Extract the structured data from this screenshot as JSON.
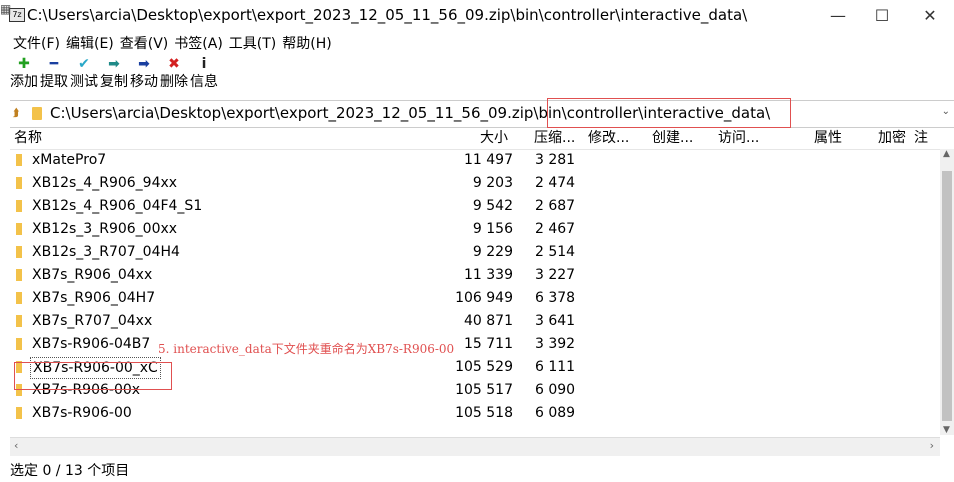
{
  "window": {
    "title": "C:\\Users\\arcia\\Desktop\\export\\export_2023_12_05_11_56_09.zip\\bin\\controller\\interactive_data\\",
    "minimize": "—",
    "maximize": "☐",
    "close": "✕"
  },
  "menu": [
    "文件(F)",
    "编辑(E)",
    "查看(V)",
    "书签(A)",
    "工具(T)",
    "帮助(H)"
  ],
  "toolbar": [
    {
      "label": "添加",
      "icon": "plus-icon",
      "glyph": "✚",
      "color": "#22a020"
    },
    {
      "label": "提取",
      "icon": "minus-icon",
      "glyph": "━",
      "color": "#1a3fa0"
    },
    {
      "label": "测试",
      "icon": "check-icon",
      "glyph": "✔",
      "color": "#2aa8c8"
    },
    {
      "label": "复制",
      "icon": "copy-arrow-icon",
      "glyph": "➡",
      "color": "#1f8a88"
    },
    {
      "label": "移动",
      "icon": "move-arrow-icon",
      "glyph": "➡",
      "color": "#1a3fa0"
    },
    {
      "label": "删除",
      "icon": "delete-icon",
      "glyph": "✖",
      "color": "#d32020"
    },
    {
      "label": "信息",
      "icon": "info-icon",
      "glyph": "i",
      "color": "#222222"
    }
  ],
  "address": {
    "path": "C:\\Users\\arcia\\Desktop\\export\\export_2023_12_05_11_56_09.zip\\bin\\controller\\interactive_data\\"
  },
  "columns": [
    "名称",
    "大小",
    "压缩...",
    "修改...",
    "创建...",
    "访问...",
    "属性",
    "加密",
    "注"
  ],
  "files": [
    {
      "name": "xMatePro7",
      "size": "11 497",
      "compressed": "3 281"
    },
    {
      "name": "XB12s_4_R906_94xx",
      "size": "9 203",
      "compressed": "2 474"
    },
    {
      "name": "XB12s_4_R906_04F4_S1",
      "size": "9 542",
      "compressed": "2 687"
    },
    {
      "name": "XB12s_3_R906_00xx",
      "size": "9 156",
      "compressed": "2 467"
    },
    {
      "name": "XB12s_3_R707_04H4",
      "size": "9 229",
      "compressed": "2 514"
    },
    {
      "name": "XB7s_R906_04xx",
      "size": "11 339",
      "compressed": "3 227"
    },
    {
      "name": "XB7s_R906_04H7",
      "size": "106 949",
      "compressed": "6 378"
    },
    {
      "name": "XB7s_R707_04xx",
      "size": "40 871",
      "compressed": "3 641"
    },
    {
      "name": "XB7s-R906-04B7",
      "size": "15 711",
      "compressed": "3 392"
    },
    {
      "name": "XB7s-R906-00_xC",
      "size": "105 529",
      "compressed": "6 111"
    },
    {
      "name": "XB7s-R906-00x",
      "size": "105 517",
      "compressed": "6 090"
    },
    {
      "name": "XB7s-R906-00",
      "size": "105 518",
      "compressed": "6 089"
    }
  ],
  "annotation": "5. interactive_data下文件夹重命名为XB7s-R906-00",
  "status": "选定 0 / 13 个项目",
  "colors": {
    "accent": "#e05050",
    "folder": "#f3c24a"
  }
}
